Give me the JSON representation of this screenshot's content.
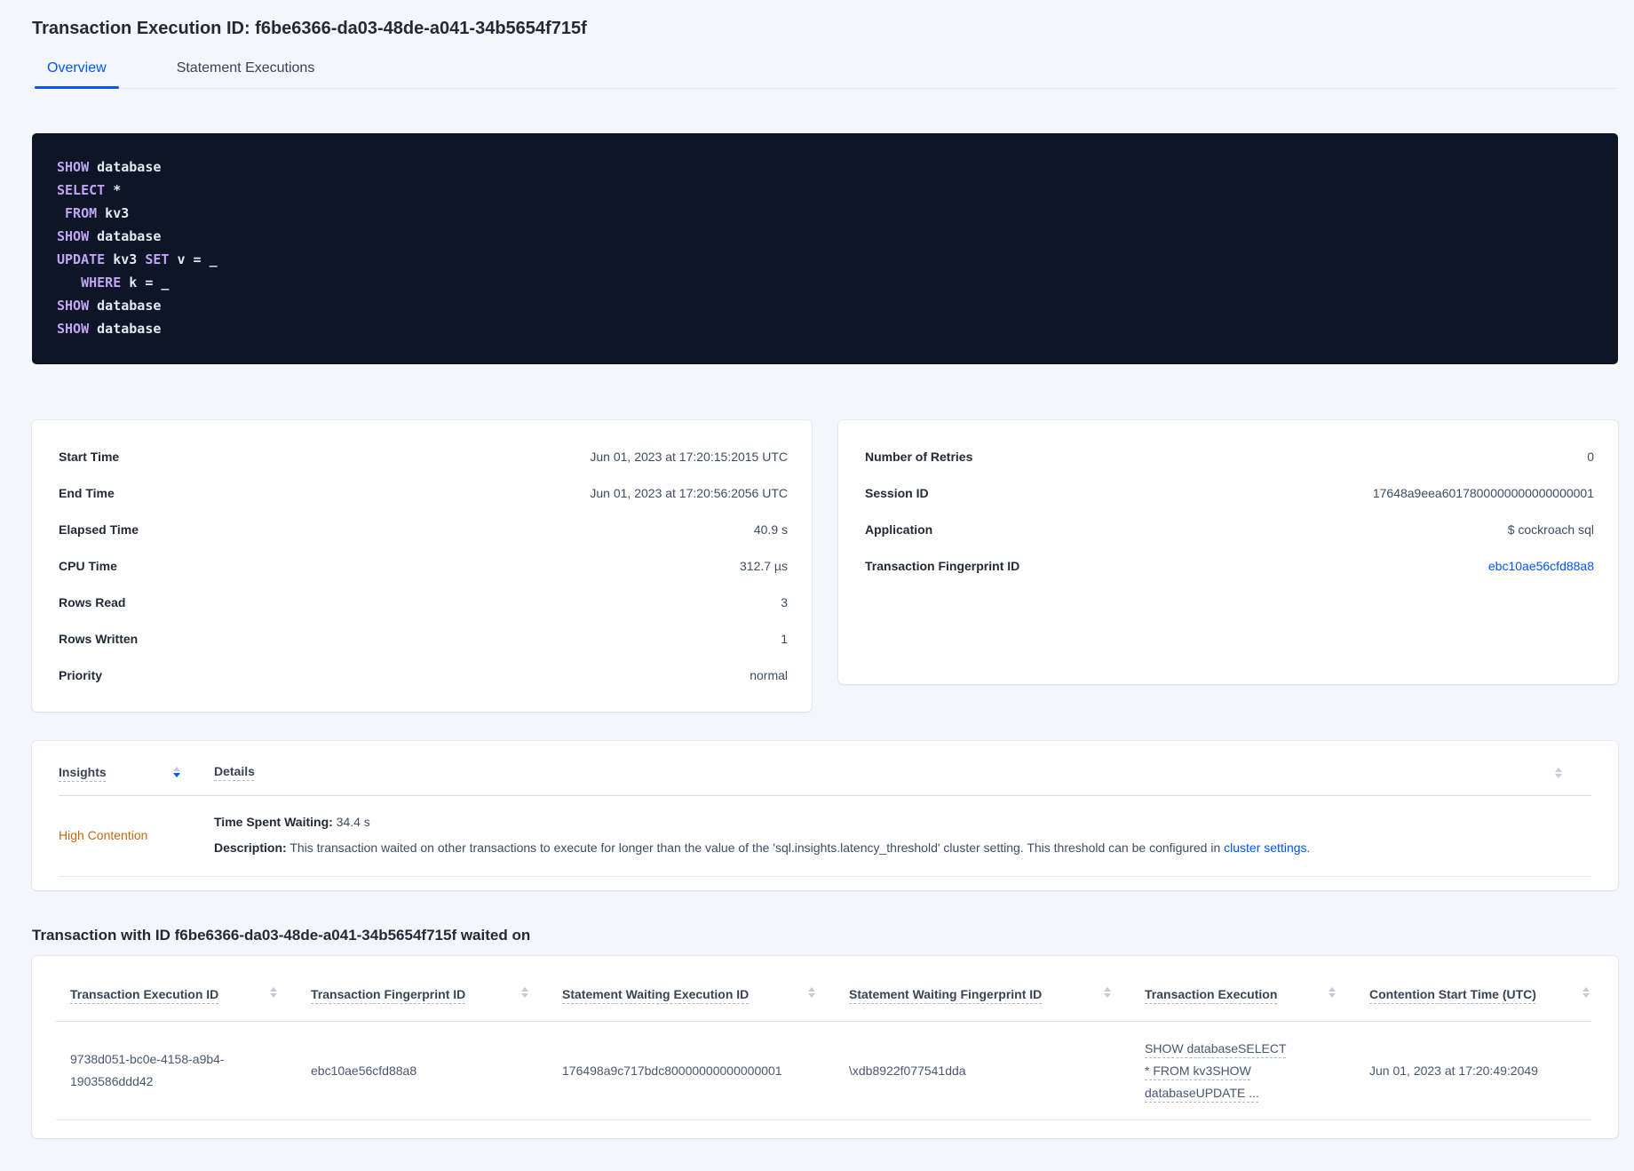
{
  "page": {
    "title": "Transaction Execution ID: f6be6366-da03-48de-a041-34b5654f715f",
    "tabs": [
      {
        "label": "Overview",
        "active": true
      },
      {
        "label": "Statement Executions",
        "active": false
      }
    ]
  },
  "colors": {
    "accent": "#0055FF",
    "link": "#0055FF",
    "insight_warning": "#C4680E",
    "code_bg": "#0D1527",
    "code_keyword": "#C0A5F3",
    "code_plain": "#E3E8F2",
    "page_bg": "#F4F6FB",
    "card_bg": "#FFFFFF",
    "heading_text": "#242A35",
    "body_text": "#475872"
  },
  "icons": {
    "sort": "up-down-triangles",
    "sort_desc_active": "down-triangle-blue"
  },
  "sql_box": {
    "lines": [
      [
        {
          "t": "k",
          "s": "SHOW"
        },
        {
          "t": "p",
          "s": " database"
        }
      ],
      [
        {
          "t": "k",
          "s": "SELECT"
        },
        {
          "t": "p",
          "s": " *"
        }
      ],
      [
        {
          "t": "p",
          "s": " "
        },
        {
          "t": "k",
          "s": "FROM"
        },
        {
          "t": "p",
          "s": " kv3"
        }
      ],
      [
        {
          "t": "k",
          "s": "SHOW"
        },
        {
          "t": "p",
          "s": " database"
        }
      ],
      [
        {
          "t": "k",
          "s": "UPDATE"
        },
        {
          "t": "p",
          "s": " kv3 "
        },
        {
          "t": "k",
          "s": "SET"
        },
        {
          "t": "p",
          "s": " v = _"
        }
      ],
      [
        {
          "t": "p",
          "s": "   "
        },
        {
          "t": "k",
          "s": "WHERE"
        },
        {
          "t": "p",
          "s": " k = _"
        }
      ],
      [
        {
          "t": "k",
          "s": "SHOW"
        },
        {
          "t": "p",
          "s": " database"
        }
      ],
      [
        {
          "t": "k",
          "s": "SHOW"
        },
        {
          "t": "p",
          "s": " database"
        }
      ]
    ]
  },
  "summary_left": {
    "rows": [
      {
        "label": "Start Time",
        "value": "Jun 01, 2023 at 17:20:15:2015 UTC"
      },
      {
        "label": "End Time",
        "value": "Jun 01, 2023 at 17:20:56:2056 UTC"
      },
      {
        "label": "Elapsed Time",
        "value": "40.9 s"
      },
      {
        "label": "CPU Time",
        "value": "312.7 µs"
      },
      {
        "label": "Rows Read",
        "value": "3"
      },
      {
        "label": "Rows Written",
        "value": "1"
      },
      {
        "label": "Priority",
        "value": "normal"
      }
    ]
  },
  "summary_right": {
    "rows": [
      {
        "label": "Number of Retries",
        "value": "0"
      },
      {
        "label": "Session ID",
        "value": "17648a9eea6017800000000000000001"
      },
      {
        "label": "Application",
        "value": "$ cockroach sql"
      },
      {
        "label": "Transaction Fingerprint ID",
        "value": "ebc10ae56cfd88a8",
        "link": true
      }
    ]
  },
  "insights": {
    "columns": [
      "Insights",
      "Details"
    ],
    "row": {
      "insight": "High Contention",
      "waiting_label": "Time Spent Waiting:",
      "waiting_value": " 34.4 s",
      "description_label": "Description:",
      "description_text": " This transaction waited on other transactions to execute for longer than the value of the 'sql.insights.latency_threshold' cluster setting. This threshold can be configured in ",
      "description_link": "cluster settings",
      "description_suffix": "."
    }
  },
  "waited_on": {
    "title": "Transaction with ID f6be6366-da03-48de-a041-34b5654f715f waited on",
    "columns": [
      "Transaction Execution ID",
      "Transaction Fingerprint ID",
      "Statement Waiting Execution ID",
      "Statement Waiting Fingerprint ID",
      "Transaction Execution",
      "Contention Start Time (UTC)"
    ],
    "row": {
      "txn_execution_id": "9738d051-bc0e-4158-a9b4-1903586ddd42",
      "txn_fingerprint_id": "ebc10ae56cfd88a8",
      "stmt_waiting_execution_id": "176498a9c717bdc80000000000000001",
      "stmt_waiting_fingerprint_id": "\\xdb8922f077541dda",
      "txn_execution": "SHOW databaseSELECT * FROM kv3SHOW databaseUPDATE ...",
      "contention_start": "Jun 01, 2023 at 17:20:49:2049"
    }
  }
}
